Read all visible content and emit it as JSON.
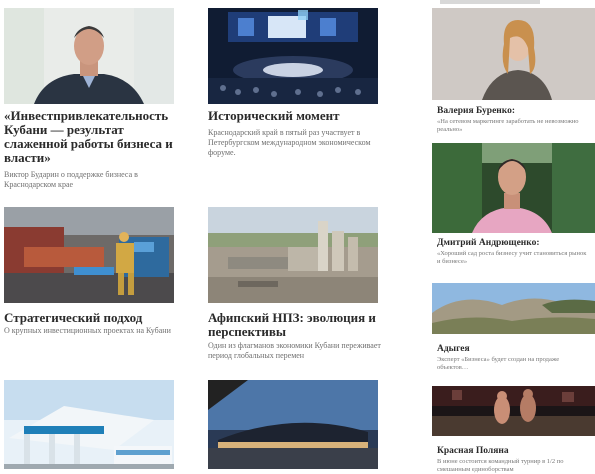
{
  "articles": [
    {
      "title": "«Инвестпривлекательность Кубани — результат слаженной работы бизнеса и власти»",
      "desc": "Виктор Бударин о поддержке бизнеса в Краснодарском крае",
      "image": "portrait-man-in-suit"
    },
    {
      "title": "Исторический момент",
      "desc": "Краснодарский край в пятый раз участвует в Петербургском международном экономическом форуме.",
      "image": "conference-hall"
    },
    {
      "title": "Стратегический подход",
      "desc": "О крупных инвестиционных проектах на Кубани",
      "image": "industrial-worker"
    },
    {
      "title": "Афипский НПЗ: эволюция и перспективы",
      "desc": "Один из флагманов экономики Кубани переживает период глобальных перемен",
      "image": "refinery"
    },
    {
      "title": "",
      "desc": "",
      "image": "gas-station"
    },
    {
      "title": "",
      "desc": "",
      "image": "airport-terminal"
    }
  ],
  "sidebar": [
    {
      "title": "Валерия Буренко:",
      "desc": "«На сетевом маркетинге заработать не невозможно реально»",
      "image": "portrait-woman"
    },
    {
      "title": "Дмитрий Андрющенко:",
      "desc": "«Хороший сад роста бизнесу учит становиться рынок и бизнесе»",
      "image": "portrait-man-pink-shirt"
    },
    {
      "title": "Адыгея",
      "desc": "Эксперт «Бизнеса» будет создан на продаже объектов…",
      "image": "mountain-landscape"
    },
    {
      "title": "Красная Поляна",
      "desc": "В июне состоится командный турнир в 1/2 по смешанным единоборствам",
      "image": "fighters-arena"
    }
  ]
}
